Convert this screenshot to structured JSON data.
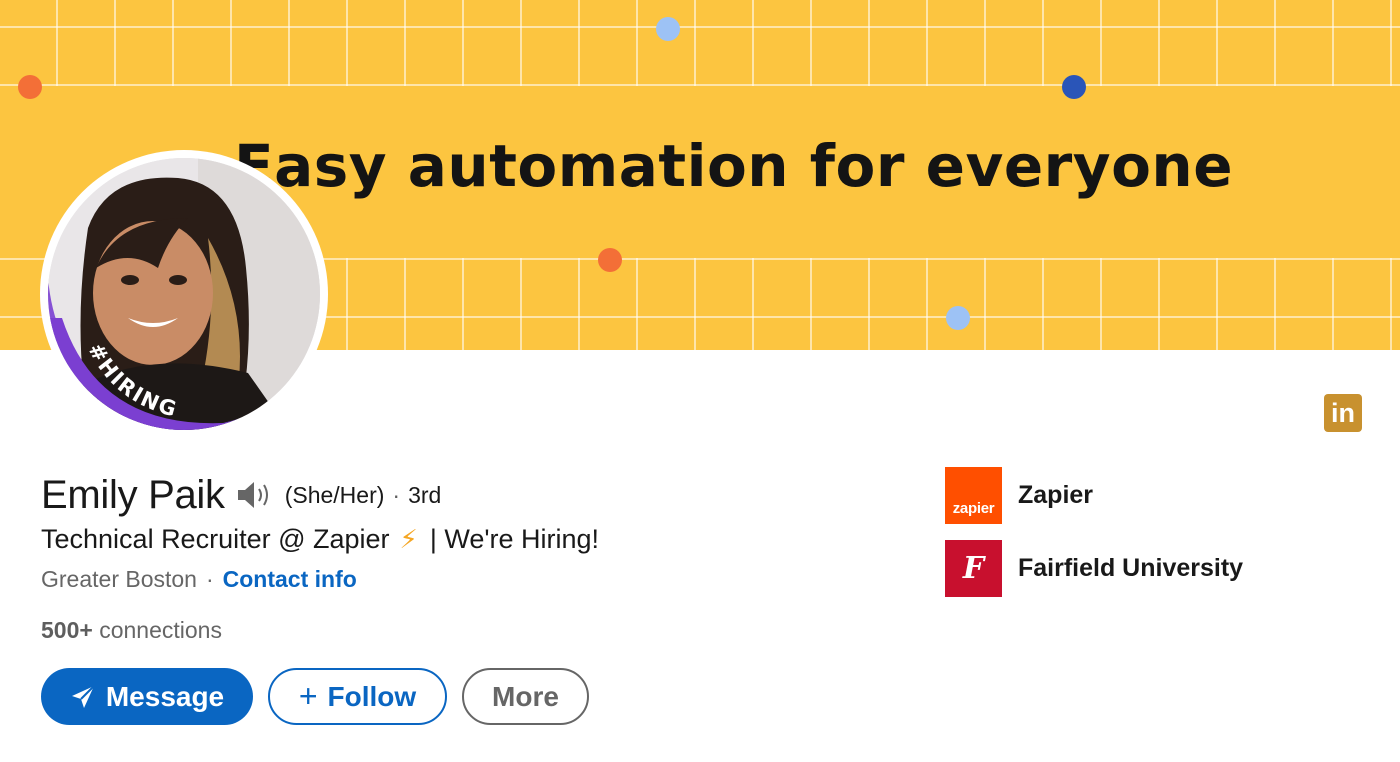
{
  "banner": {
    "tagline": "Easy automation for everyone",
    "background_color": "#fcc540",
    "dot_colors": [
      "#f36f37",
      "#9dc2f5",
      "#2a55b8"
    ]
  },
  "profile": {
    "badge_text": "#HIRING",
    "badge_color": "#7b3fd1",
    "name": "Emily Paik",
    "pronouns": "(She/Her)",
    "separator": "·",
    "degree": "3rd",
    "headline_prefix": "Technical Recruiter @ Zapier",
    "headline_emoji": "⚡",
    "headline_suffix": "| We're Hiring!",
    "location": "Greater Boston",
    "contact_label": "Contact info",
    "connections_count": "500+",
    "connections_label": "connections"
  },
  "actions": {
    "message_label": "Message",
    "follow_label": "Follow",
    "follow_prefix": "+",
    "more_label": "More"
  },
  "organizations": [
    {
      "name": "Zapier",
      "logo_text": "zapier",
      "logo_color": "#ff4f00",
      "icon": "zapier-logo"
    },
    {
      "name": "Fairfield University",
      "logo_text": "F",
      "logo_color": "#c8102e",
      "icon": "fairfield-logo"
    }
  ],
  "brand": {
    "logo_text": "in",
    "icon": "linkedin-logo",
    "color": "#c8912f"
  },
  "accent_color": "#0a66c2"
}
